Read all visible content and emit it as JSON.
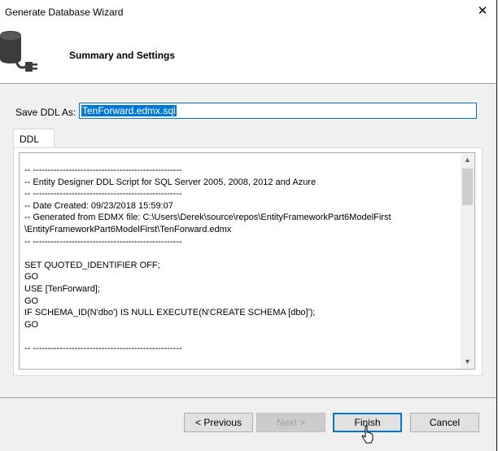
{
  "window": {
    "title": "Generate Database Wizard",
    "close_glyph": "✕"
  },
  "header": {
    "title": "Summary and Settings",
    "icon": "database-connect-icon"
  },
  "save_ddl": {
    "label": "Save DDL As:",
    "value": "TenForward.edmx.sql"
  },
  "tabs": [
    {
      "label": "DDL"
    }
  ],
  "ddl": {
    "text": "-- --------------------------------------------------\n-- Entity Designer DDL Script for SQL Server 2005, 2008, 2012 and Azure\n-- --------------------------------------------------\n-- Date Created: 09/23/2018 15:59:07\n-- Generated from EDMX file: C:\\Users\\Derek\\source\\repos\\EntityFrameworkPart6ModelFirst\n\\EntityFrameworkPart6ModelFirst\\TenForward.edmx\n-- --------------------------------------------------\n\nSET QUOTED_IDENTIFIER OFF;\nGO\nUSE [TenForward];\nGO\nIF SCHEMA_ID(N'dbo') IS NULL EXECUTE(N'CREATE SCHEMA [dbo]');\nGO\n\n-- --------------------------------------------------"
  },
  "buttons": {
    "previous": "< Previous",
    "next": "Next >",
    "finish": "Finish",
    "cancel": "Cancel"
  },
  "colors": {
    "accent": "#0078d7",
    "background": "#f0f0f0"
  }
}
